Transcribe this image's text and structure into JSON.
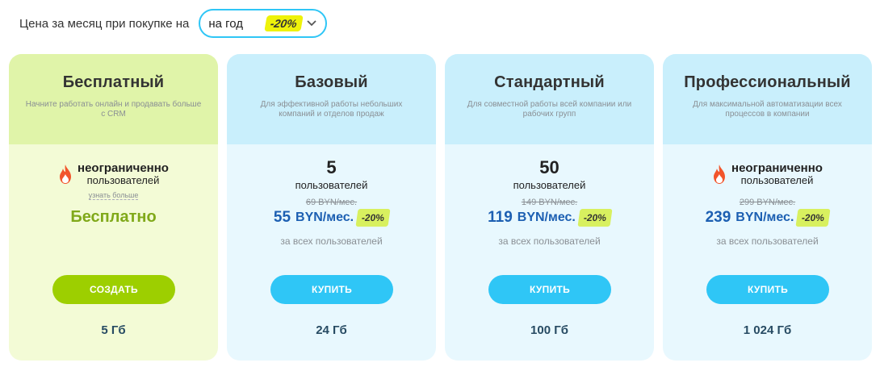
{
  "topbar": {
    "label": "Цена за месяц при покупке на",
    "period": "на год",
    "discount": "-20%"
  },
  "plans": [
    {
      "title": "Бесплатный",
      "desc": "Начните работать онлайн и продавать больше с CRM",
      "users_main": "неограниченно",
      "users_sub": "пользователей",
      "learn_more": "узнать больше",
      "price": "Бесплатно",
      "button": "СОЗДАТЬ",
      "storage": "5 Гб"
    },
    {
      "title": "Базовый",
      "desc": "Для эффективной работы небольших компаний и отделов продаж",
      "users_count": "5",
      "users_label": "пользователей",
      "old_price": "69 BYN/мес.",
      "price_value": "55",
      "price_unit": "BYN/мес.",
      "discount": "-20%",
      "per_users": "за всех пользователей",
      "button": "КУПИТЬ",
      "storage": "24 Гб"
    },
    {
      "title": "Стандартный",
      "desc": "Для совместной работы всей компании или рабочих групп",
      "users_count": "50",
      "users_label": "пользователей",
      "old_price": "149 BYN/мес.",
      "price_value": "119",
      "price_unit": "BYN/мес.",
      "discount": "-20%",
      "per_users": "за всех пользователей",
      "button": "КУПИТЬ",
      "storage": "100 Гб"
    },
    {
      "title": "Профессиональный",
      "desc": "Для максимальной автоматизации всех процессов в компании",
      "users_main": "неограниченно",
      "users_sub": "пользователей",
      "old_price": "299 BYN/мес.",
      "price_value": "239",
      "price_unit": "BYN/мес.",
      "discount": "-20%",
      "per_users": "за всех пользователей",
      "button": "КУПИТЬ",
      "storage": "1 024 Гб"
    }
  ],
  "icons": {
    "fire": "fire-icon",
    "chevron": "chevron-down-icon"
  },
  "colors": {
    "accent_blue": "#2fc6f6",
    "accent_green": "#9dcf00",
    "price_blue": "#1c5fb2",
    "free_green": "#80a91a",
    "badge_yellow": "#eef20a"
  }
}
